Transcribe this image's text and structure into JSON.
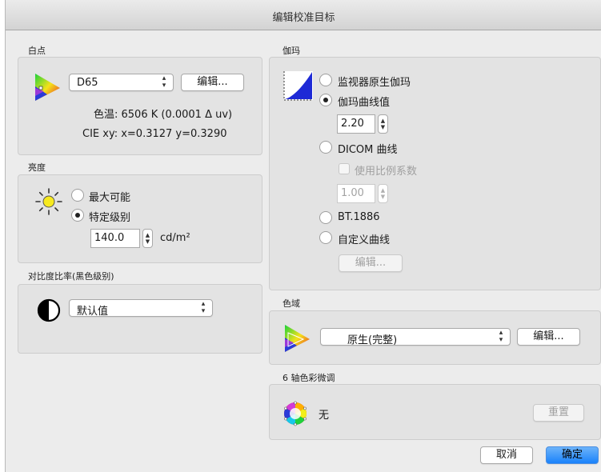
{
  "window": {
    "title": "编辑校准目标"
  },
  "whitepoint": {
    "section_title": "白点",
    "preset": "D65",
    "edit_label": "编辑...",
    "color_temp": "色温:  6506 K (0.0001 Δ uv)",
    "cie_xy": "CIE xy:  x=0.3127 y=0.3290"
  },
  "brightness": {
    "section_title": "亮度",
    "option_max": "最大可能",
    "option_specific": "特定级别",
    "value": "140.0",
    "unit": "cd/m²"
  },
  "contrast": {
    "section_title": "对比度比率(黑色级别)",
    "selected": "默认值"
  },
  "gamma": {
    "section_title": "伽玛",
    "option_native": "监视器原生伽玛",
    "option_curve_value": "伽玛曲线值",
    "curve_value": "2.20",
    "option_dicom": "DICOM 曲线",
    "use_scale_factor": "使用比例系数",
    "scale_value": "1.00",
    "option_bt1886": "BT.1886",
    "option_custom": "自定义曲线",
    "edit_label": "编辑..."
  },
  "gamut": {
    "section_title": "色域",
    "selected": "原生(完整)",
    "edit_label": "编辑..."
  },
  "six_axis": {
    "section_title": "6 轴色彩微调",
    "status": "无",
    "reset_label": "重置"
  },
  "footer": {
    "cancel_label": "取消",
    "ok_label": "确定"
  }
}
